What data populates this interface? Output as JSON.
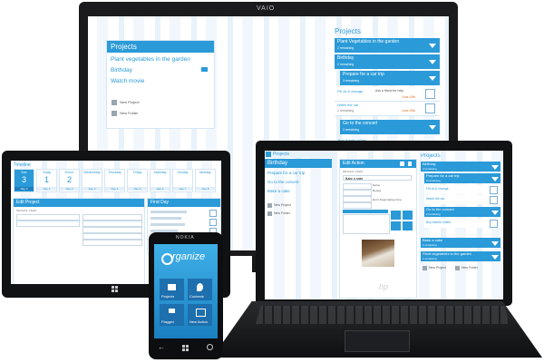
{
  "monitor": {
    "brand": "VAIO",
    "left_panel": {
      "title": "Projects",
      "items": [
        "Plant vegetables in the garden",
        "Birthday",
        "Watch movie"
      ],
      "actions": [
        "New Project",
        "New Folder"
      ]
    },
    "right_panel": {
      "title": "Projects",
      "rows": [
        {
          "label": "Plant Vegetables in the garden",
          "sub": "2 remaining"
        },
        {
          "label": "Birthday",
          "sub": "2 remaining"
        },
        {
          "label": "Prepare for a car trip",
          "sub": "3 remaining"
        }
      ],
      "tasks": [
        {
          "label": "Fill oil & change",
          "note": "Ask a friend for help",
          "due": "June 24th"
        },
        {
          "label": "Wash the car",
          "sub": "1 remaining",
          "due": "June 26th"
        }
      ],
      "concert": {
        "label": "Go to the concert",
        "sub": "3 remaining"
      },
      "footer": "Buy tickets online"
    }
  },
  "tablet": {
    "title": "Timeline",
    "days": [
      {
        "name": "Sun",
        "num": "3",
        "sub": "Day 0"
      },
      {
        "name": "Today",
        "num": "1",
        "sub": "Day 1"
      },
      {
        "name": "Tomor.",
        "num": "2",
        "sub": "Day 2"
      },
      {
        "name": "Wednesday",
        "num": "",
        "sub": "Day 3"
      },
      {
        "name": "Thursday",
        "num": "",
        "sub": "Day 4"
      },
      {
        "name": "Friday",
        "num": "",
        "sub": "Day 5"
      },
      {
        "name": "Saturday",
        "num": "",
        "sub": "Day 6"
      },
      {
        "name": "Sunday",
        "num": "",
        "sub": "Day 7"
      },
      {
        "name": "Monday",
        "num": "",
        "sub": "Day 8"
      }
    ],
    "edit_title": "Edit Project",
    "details": "DETAILS: FILES",
    "first_day": "First Day"
  },
  "phone": {
    "brand": "NOKIA",
    "logo": "rganize",
    "tiles": [
      "Projects",
      "Contexts",
      "Flagged",
      "New Action"
    ]
  },
  "laptop": {
    "brand": "hp",
    "left": {
      "header": "Projects",
      "bar": "Birthday",
      "items": [
        "Prepare for a car trip",
        "Go to the concert",
        "Bake a cake"
      ],
      "actions": [
        "New Project",
        "New Folder"
      ]
    },
    "middle": {
      "header": "Edit Action",
      "details": "DETAILS: FILES",
      "field": "Bake a cake",
      "list_header": "Name",
      "list": [
        "Recipe"
      ],
      "note": "Don't forget taking Anne"
    },
    "right": {
      "title": "Projects",
      "rows": [
        {
          "label": "Birthday",
          "sub": "2 remaining"
        },
        {
          "label": "Prepare for a car trip",
          "sub": "3 remaining"
        },
        {
          "label": "Go to the concert",
          "sub": "2 remaining"
        },
        {
          "label": "Bake a cake",
          "sub": "1 remaining"
        },
        {
          "label": "Plant vegetables in the garden",
          "sub": "1 remaining"
        }
      ],
      "tasks": [
        "Fill oil & change",
        "Wash the car",
        "Buy tickets online"
      ],
      "actions": [
        "New Project",
        "New Folder"
      ]
    }
  }
}
